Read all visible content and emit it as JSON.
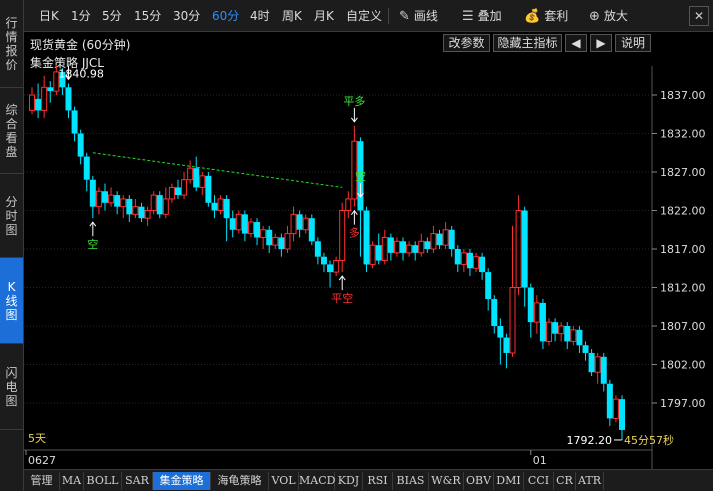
{
  "sidebar": {
    "items": [
      {
        "label": "行情报价",
        "active": false
      },
      {
        "label": "综合看盘",
        "active": false
      },
      {
        "label": "分时图",
        "active": false
      },
      {
        "label": "K线图",
        "active": true
      },
      {
        "label": "闪电图",
        "active": false
      }
    ]
  },
  "toolbar": {
    "periods": [
      "日K",
      "1分",
      "5分",
      "15分",
      "30分",
      "60分",
      "4时",
      "周K",
      "月K",
      "自定义"
    ],
    "active_period": "60分",
    "tools": [
      {
        "label": "画线",
        "icon": "pencil-icon"
      },
      {
        "label": "叠加",
        "icon": "stack-icon"
      },
      {
        "label": "套利",
        "icon": "moneybag-icon"
      },
      {
        "label": "放大",
        "icon": "zoom-in-icon"
      }
    ],
    "close_glyph": "✕"
  },
  "header": {
    "title": "现货黄金 (60分钟)",
    "buttons": [
      "改参数",
      "隐藏主指标",
      "◀",
      "▶",
      "说明"
    ],
    "indicator": "集金策略 JJCL"
  },
  "bottom_tabs": [
    "管理",
    "MA",
    "BOLL",
    "SAR",
    "集金策略",
    "海龟策略",
    "VOL",
    "MACD",
    "KDJ",
    "RSI",
    "BIAS",
    "W&R",
    "OBV",
    "DMI",
    "CCI",
    "CR",
    "ATR"
  ],
  "active_bottom_tab": "集金策略",
  "colors": {
    "up": "#ff3030",
    "down": "#00e5ff",
    "signal_green": "#39e639",
    "signal_red": "#ff3030",
    "trend": "#22dd22",
    "accent": "#1c6fd8"
  },
  "chart_data": {
    "type": "candlestick",
    "y_ticks": [
      1837.0,
      1832.0,
      1827.0,
      1822.0,
      1817.0,
      1812.0,
      1807.0,
      1802.0,
      1797.0
    ],
    "y_tick_labels": [
      "1837.00",
      "1832.00",
      "1827.00",
      "1822.00",
      "1817.00",
      "1812.00",
      "1807.00",
      "1802.00",
      "1797.00"
    ],
    "ylim": [
      1792.2,
      1840.98
    ],
    "x_labels": [
      {
        "index": 0,
        "label": "0627"
      },
      {
        "index": 82,
        "label": "01"
      }
    ],
    "high_label": "1840.98",
    "low_label": "1792.20",
    "period_note": "5天",
    "countdown": "45分57秒",
    "candles": [
      {
        "o": 1835.0,
        "c": 1837.0,
        "h": 1838.0,
        "l": 1834.5
      },
      {
        "o": 1836.5,
        "c": 1835.0,
        "h": 1838.5,
        "l": 1834.0
      },
      {
        "o": 1835.0,
        "c": 1838.0,
        "h": 1839.5,
        "l": 1834.0
      },
      {
        "o": 1838.0,
        "c": 1837.5,
        "h": 1838.8,
        "l": 1836.0
      },
      {
        "o": 1837.5,
        "c": 1840.0,
        "h": 1840.98,
        "l": 1837.0
      },
      {
        "o": 1840.0,
        "c": 1838.0,
        "h": 1840.5,
        "l": 1837.0
      },
      {
        "o": 1838.0,
        "c": 1835.0,
        "h": 1838.5,
        "l": 1834.0
      },
      {
        "o": 1835.0,
        "c": 1832.0,
        "h": 1835.5,
        "l": 1831.0
      },
      {
        "o": 1832.0,
        "c": 1829.0,
        "h": 1832.5,
        "l": 1828.0
      },
      {
        "o": 1829.0,
        "c": 1826.0,
        "h": 1829.5,
        "l": 1824.5
      },
      {
        "o": 1826.0,
        "c": 1822.5,
        "h": 1826.5,
        "l": 1821.0
      },
      {
        "o": 1822.5,
        "c": 1824.5,
        "h": 1825.0,
        "l": 1821.5
      },
      {
        "o": 1824.5,
        "c": 1823.0,
        "h": 1825.5,
        "l": 1822.0
      },
      {
        "o": 1823.0,
        "c": 1824.0,
        "h": 1825.0,
        "l": 1822.5
      },
      {
        "o": 1824.0,
        "c": 1822.5,
        "h": 1824.5,
        "l": 1821.5
      },
      {
        "o": 1822.5,
        "c": 1823.5,
        "h": 1824.0,
        "l": 1821.0
      },
      {
        "o": 1823.5,
        "c": 1821.5,
        "h": 1824.0,
        "l": 1820.5
      },
      {
        "o": 1821.5,
        "c": 1822.5,
        "h": 1823.5,
        "l": 1821.0
      },
      {
        "o": 1822.5,
        "c": 1821.0,
        "h": 1823.0,
        "l": 1820.5
      },
      {
        "o": 1821.0,
        "c": 1822.0,
        "h": 1822.5,
        "l": 1820.0
      },
      {
        "o": 1822.0,
        "c": 1824.0,
        "h": 1824.5,
        "l": 1821.5
      },
      {
        "o": 1824.0,
        "c": 1821.5,
        "h": 1824.5,
        "l": 1821.0
      },
      {
        "o": 1821.5,
        "c": 1823.5,
        "h": 1825.0,
        "l": 1821.0
      },
      {
        "o": 1823.5,
        "c": 1825.0,
        "h": 1825.5,
        "l": 1823.0
      },
      {
        "o": 1825.0,
        "c": 1824.0,
        "h": 1826.0,
        "l": 1823.5
      },
      {
        "o": 1824.0,
        "c": 1826.0,
        "h": 1827.0,
        "l": 1823.5
      },
      {
        "o": 1826.0,
        "c": 1827.5,
        "h": 1828.5,
        "l": 1825.5
      },
      {
        "o": 1827.5,
        "c": 1825.0,
        "h": 1829.0,
        "l": 1824.5
      },
      {
        "o": 1825.0,
        "c": 1826.5,
        "h": 1827.0,
        "l": 1824.0
      },
      {
        "o": 1826.5,
        "c": 1823.0,
        "h": 1827.0,
        "l": 1822.5
      },
      {
        "o": 1823.0,
        "c": 1822.0,
        "h": 1824.0,
        "l": 1821.0
      },
      {
        "o": 1822.0,
        "c": 1823.5,
        "h": 1824.0,
        "l": 1821.5
      },
      {
        "o": 1823.5,
        "c": 1821.0,
        "h": 1824.0,
        "l": 1818.0
      },
      {
        "o": 1821.0,
        "c": 1819.5,
        "h": 1822.0,
        "l": 1818.5
      },
      {
        "o": 1819.5,
        "c": 1821.5,
        "h": 1822.0,
        "l": 1819.0
      },
      {
        "o": 1821.5,
        "c": 1819.0,
        "h": 1822.0,
        "l": 1818.0
      },
      {
        "o": 1819.0,
        "c": 1820.5,
        "h": 1821.0,
        "l": 1818.5
      },
      {
        "o": 1820.5,
        "c": 1818.5,
        "h": 1821.0,
        "l": 1817.5
      },
      {
        "o": 1818.5,
        "c": 1819.5,
        "h": 1820.0,
        "l": 1817.0
      },
      {
        "o": 1819.5,
        "c": 1817.5,
        "h": 1820.0,
        "l": 1816.5
      },
      {
        "o": 1817.5,
        "c": 1818.5,
        "h": 1819.0,
        "l": 1817.0
      },
      {
        "o": 1818.5,
        "c": 1817.0,
        "h": 1819.0,
        "l": 1816.0
      },
      {
        "o": 1817.0,
        "c": 1819.0,
        "h": 1820.0,
        "l": 1816.5
      },
      {
        "o": 1819.0,
        "c": 1821.5,
        "h": 1822.5,
        "l": 1818.0
      },
      {
        "o": 1821.5,
        "c": 1819.5,
        "h": 1822.0,
        "l": 1818.5
      },
      {
        "o": 1819.5,
        "c": 1821.0,
        "h": 1821.5,
        "l": 1819.0
      },
      {
        "o": 1821.0,
        "c": 1818.0,
        "h": 1821.5,
        "l": 1817.5
      },
      {
        "o": 1818.0,
        "c": 1816.0,
        "h": 1818.5,
        "l": 1815.0
      },
      {
        "o": 1816.0,
        "c": 1815.0,
        "h": 1816.5,
        "l": 1814.0
      },
      {
        "o": 1815.0,
        "c": 1814.0,
        "h": 1815.5,
        "l": 1812.0
      },
      {
        "o": 1814.0,
        "c": 1815.5,
        "h": 1816.0,
        "l": 1813.5
      },
      {
        "o": 1815.5,
        "c": 1822.0,
        "h": 1823.0,
        "l": 1814.0
      },
      {
        "o": 1822.0,
        "c": 1823.5,
        "h": 1824.5,
        "l": 1821.0
      },
      {
        "o": 1823.5,
        "c": 1831.0,
        "h": 1833.0,
        "l": 1822.5
      },
      {
        "o": 1831.0,
        "c": 1822.0,
        "h": 1831.5,
        "l": 1816.0
      },
      {
        "o": 1822.0,
        "c": 1815.0,
        "h": 1822.5,
        "l": 1814.0
      },
      {
        "o": 1815.0,
        "c": 1817.5,
        "h": 1818.0,
        "l": 1814.5
      },
      {
        "o": 1817.5,
        "c": 1815.5,
        "h": 1819.0,
        "l": 1815.0
      },
      {
        "o": 1815.5,
        "c": 1818.5,
        "h": 1819.5,
        "l": 1815.0
      },
      {
        "o": 1818.5,
        "c": 1816.5,
        "h": 1819.0,
        "l": 1815.5
      },
      {
        "o": 1816.5,
        "c": 1818.0,
        "h": 1818.5,
        "l": 1816.0
      },
      {
        "o": 1818.0,
        "c": 1816.5,
        "h": 1818.5,
        "l": 1815.5
      },
      {
        "o": 1816.5,
        "c": 1817.5,
        "h": 1818.0,
        "l": 1816.0
      },
      {
        "o": 1817.5,
        "c": 1816.5,
        "h": 1818.0,
        "l": 1815.5
      },
      {
        "o": 1816.5,
        "c": 1818.0,
        "h": 1819.0,
        "l": 1816.0
      },
      {
        "o": 1818.0,
        "c": 1817.0,
        "h": 1818.5,
        "l": 1816.5
      },
      {
        "o": 1817.0,
        "c": 1819.0,
        "h": 1820.0,
        "l": 1816.5
      },
      {
        "o": 1819.0,
        "c": 1817.5,
        "h": 1819.5,
        "l": 1817.0
      },
      {
        "o": 1817.5,
        "c": 1819.5,
        "h": 1820.5,
        "l": 1817.0
      },
      {
        "o": 1819.5,
        "c": 1817.0,
        "h": 1820.0,
        "l": 1816.0
      },
      {
        "o": 1817.0,
        "c": 1815.0,
        "h": 1817.5,
        "l": 1814.0
      },
      {
        "o": 1815.0,
        "c": 1816.5,
        "h": 1817.0,
        "l": 1814.0
      },
      {
        "o": 1816.5,
        "c": 1814.5,
        "h": 1817.0,
        "l": 1813.5
      },
      {
        "o": 1814.5,
        "c": 1816.0,
        "h": 1816.5,
        "l": 1814.0
      },
      {
        "o": 1816.0,
        "c": 1814.0,
        "h": 1816.5,
        "l": 1813.0
      },
      {
        "o": 1814.0,
        "c": 1810.5,
        "h": 1814.5,
        "l": 1809.0
      },
      {
        "o": 1810.5,
        "c": 1807.0,
        "h": 1811.0,
        "l": 1806.0
      },
      {
        "o": 1807.0,
        "c": 1805.5,
        "h": 1808.0,
        "l": 1802.0
      },
      {
        "o": 1805.5,
        "c": 1803.5,
        "h": 1806.0,
        "l": 1801.5
      },
      {
        "o": 1803.5,
        "c": 1812.0,
        "h": 1820.0,
        "l": 1803.0
      },
      {
        "o": 1812.0,
        "c": 1822.0,
        "h": 1824.0,
        "l": 1811.0
      },
      {
        "o": 1822.0,
        "c": 1812.0,
        "h": 1822.5,
        "l": 1809.5
      },
      {
        "o": 1812.0,
        "c": 1807.5,
        "h": 1812.5,
        "l": 1805.5
      },
      {
        "o": 1807.5,
        "c": 1810.0,
        "h": 1811.0,
        "l": 1806.0
      },
      {
        "o": 1810.0,
        "c": 1805.0,
        "h": 1810.5,
        "l": 1804.0
      },
      {
        "o": 1805.0,
        "c": 1807.5,
        "h": 1808.0,
        "l": 1804.5
      },
      {
        "o": 1807.5,
        "c": 1806.0,
        "h": 1808.0,
        "l": 1805.0
      },
      {
        "o": 1806.0,
        "c": 1807.0,
        "h": 1807.5,
        "l": 1805.0
      },
      {
        "o": 1807.0,
        "c": 1805.0,
        "h": 1807.5,
        "l": 1804.0
      },
      {
        "o": 1805.0,
        "c": 1806.5,
        "h": 1807.0,
        "l": 1804.5
      },
      {
        "o": 1806.5,
        "c": 1804.5,
        "h": 1807.0,
        "l": 1803.5
      },
      {
        "o": 1804.5,
        "c": 1803.5,
        "h": 1805.0,
        "l": 1802.5
      },
      {
        "o": 1803.5,
        "c": 1801.0,
        "h": 1804.0,
        "l": 1800.5
      },
      {
        "o": 1801.0,
        "c": 1803.0,
        "h": 1803.5,
        "l": 1799.5
      },
      {
        "o": 1803.0,
        "c": 1799.5,
        "h": 1803.5,
        "l": 1798.5
      },
      {
        "o": 1799.5,
        "c": 1795.0,
        "h": 1800.0,
        "l": 1794.0
      },
      {
        "o": 1795.0,
        "c": 1797.5,
        "h": 1798.0,
        "l": 1794.5
      },
      {
        "o": 1797.5,
        "c": 1793.5,
        "h": 1798.0,
        "l": 1792.2
      }
    ],
    "signals": [
      {
        "index": 6,
        "text": "平多",
        "dir": "down",
        "color": "green",
        "at": "high"
      },
      {
        "index": 10,
        "text": "空",
        "dir": "up",
        "color": "green",
        "at": "low"
      },
      {
        "index": 51,
        "text": "平空",
        "dir": "up",
        "color": "red",
        "at": "low"
      },
      {
        "index": 53,
        "text": "平多",
        "dir": "down",
        "color": "green",
        "at": "high"
      },
      {
        "index": 53,
        "text": "多",
        "dir": "up",
        "color": "red",
        "at": "low"
      },
      {
        "index": 54,
        "text": "空",
        "dir": "down",
        "color": "green",
        "at": "mid"
      }
    ],
    "trendline": {
      "from_index": 10,
      "from_value": 1829.5,
      "to_index": 51,
      "to_value": 1825.0
    }
  }
}
